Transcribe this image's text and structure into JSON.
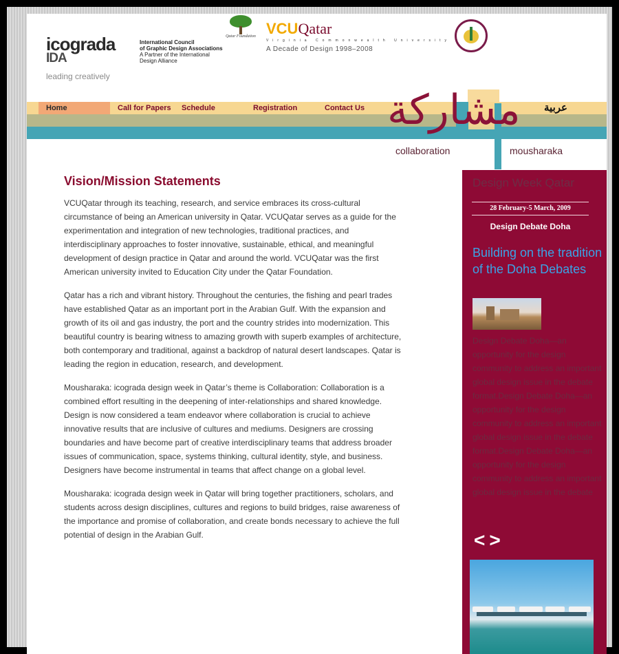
{
  "header": {
    "icograda_title": "icograda",
    "icograda_ida": "IDA",
    "icograda_tagline": "leading creatively",
    "council_line1": "International Council",
    "council_line2": "of Graphic Design Associations",
    "council_line3": "A Partner of the International",
    "council_line4": "Design Alliance",
    "qf_text": "Qatar Foundation",
    "vcu_main": "VCU",
    "vcu_qatar": "Qatar",
    "vcu_sub": "Virginia Commonwealth University",
    "vcu_decade": "A Decade of Design 1998–2008"
  },
  "nav": {
    "items": [
      "Home",
      "Call for Papers",
      "Schedule",
      "Registration",
      "Contact Us"
    ],
    "arabic": "عربية"
  },
  "banner": {
    "calligraphy": "مشاركة",
    "collaboration": "collaboration",
    "mousharaka": "mousharaka"
  },
  "main": {
    "title": "Vision/Mission Statements",
    "paragraphs": [
      "VCUQatar through its teaching, research, and service embraces its cross-cultural circumstance of being an American university in Qatar. VCUQatar serves as a guide for the experimentation and integration of new technologies, traditional practices, and interdisciplinary approaches to foster innovative, sustainable, ethical, and meaningful development of design practice in Qatar and around the world. VCUQatar was the first American university invited to Education City under the Qatar Foundation.",
      "Qatar has a rich and vibrant history. Throughout the centuries, the fishing and pearl trades have established Qatar as an important port in the Arabian Gulf. With the expansion and growth of its oil and gas industry, the port and the country strides into modernization. This beautiful country is bearing witness to amazing growth with superb examples of architecture, both contemporary and traditional, against a backdrop of natural desert landscapes. Qatar is leading the region in education, research, and development.",
      "Mousharaka: icograda design week in Qatar’s theme is Collaboration: Collaboration is a combined effort resulting in the deepening of inter-relationships and shared knowledge. Design is now considered a team endeavor where collaboration is crucial to achieve innovative results that are inclusive of cultures and mediums. Designers are crossing boundaries and have become part of creative interdisciplinary teams that address broader issues of communication, space, systems thinking, cultural identity, style, and business. Designers have become instrumental in teams that affect change on a global level.",
      "Mousharaka: icograda design week in Qatar will bring together practitioners, scholars, and students across design disciplines, cultures and regions to build bridges, raise awareness of the importance and promise of collaboration, and create bonds necessary to achieve the full potential of design in the Arabian Gulf."
    ]
  },
  "sidebar": {
    "title": "Design Week Qatar",
    "date": "28 February-5 March, 2009",
    "subtitle": "Design Debate Doha",
    "headline": "Building on the tradition of the Doha Debates",
    "body": "Design Debate Doha—an opportunity for the design community to address an important global design issue in the debate format.Design Debate Doha—an opportunity for the design community to address an important global design issue in the debate format.Design Debate Doha—an opportunity for the design community to address an important global design issue in the debate",
    "prev_icon": "chevron-left-icon",
    "next_icon": "chevron-right-icon",
    "prev_glyph": "<",
    "next_glyph": ">"
  },
  "colors": {
    "accent_maroon": "#8e0a35",
    "nav_peach": "#f7d792",
    "nav_olive": "#b7b78a",
    "nav_teal": "#45a5b5",
    "link_blue": "#3ba3e6"
  }
}
